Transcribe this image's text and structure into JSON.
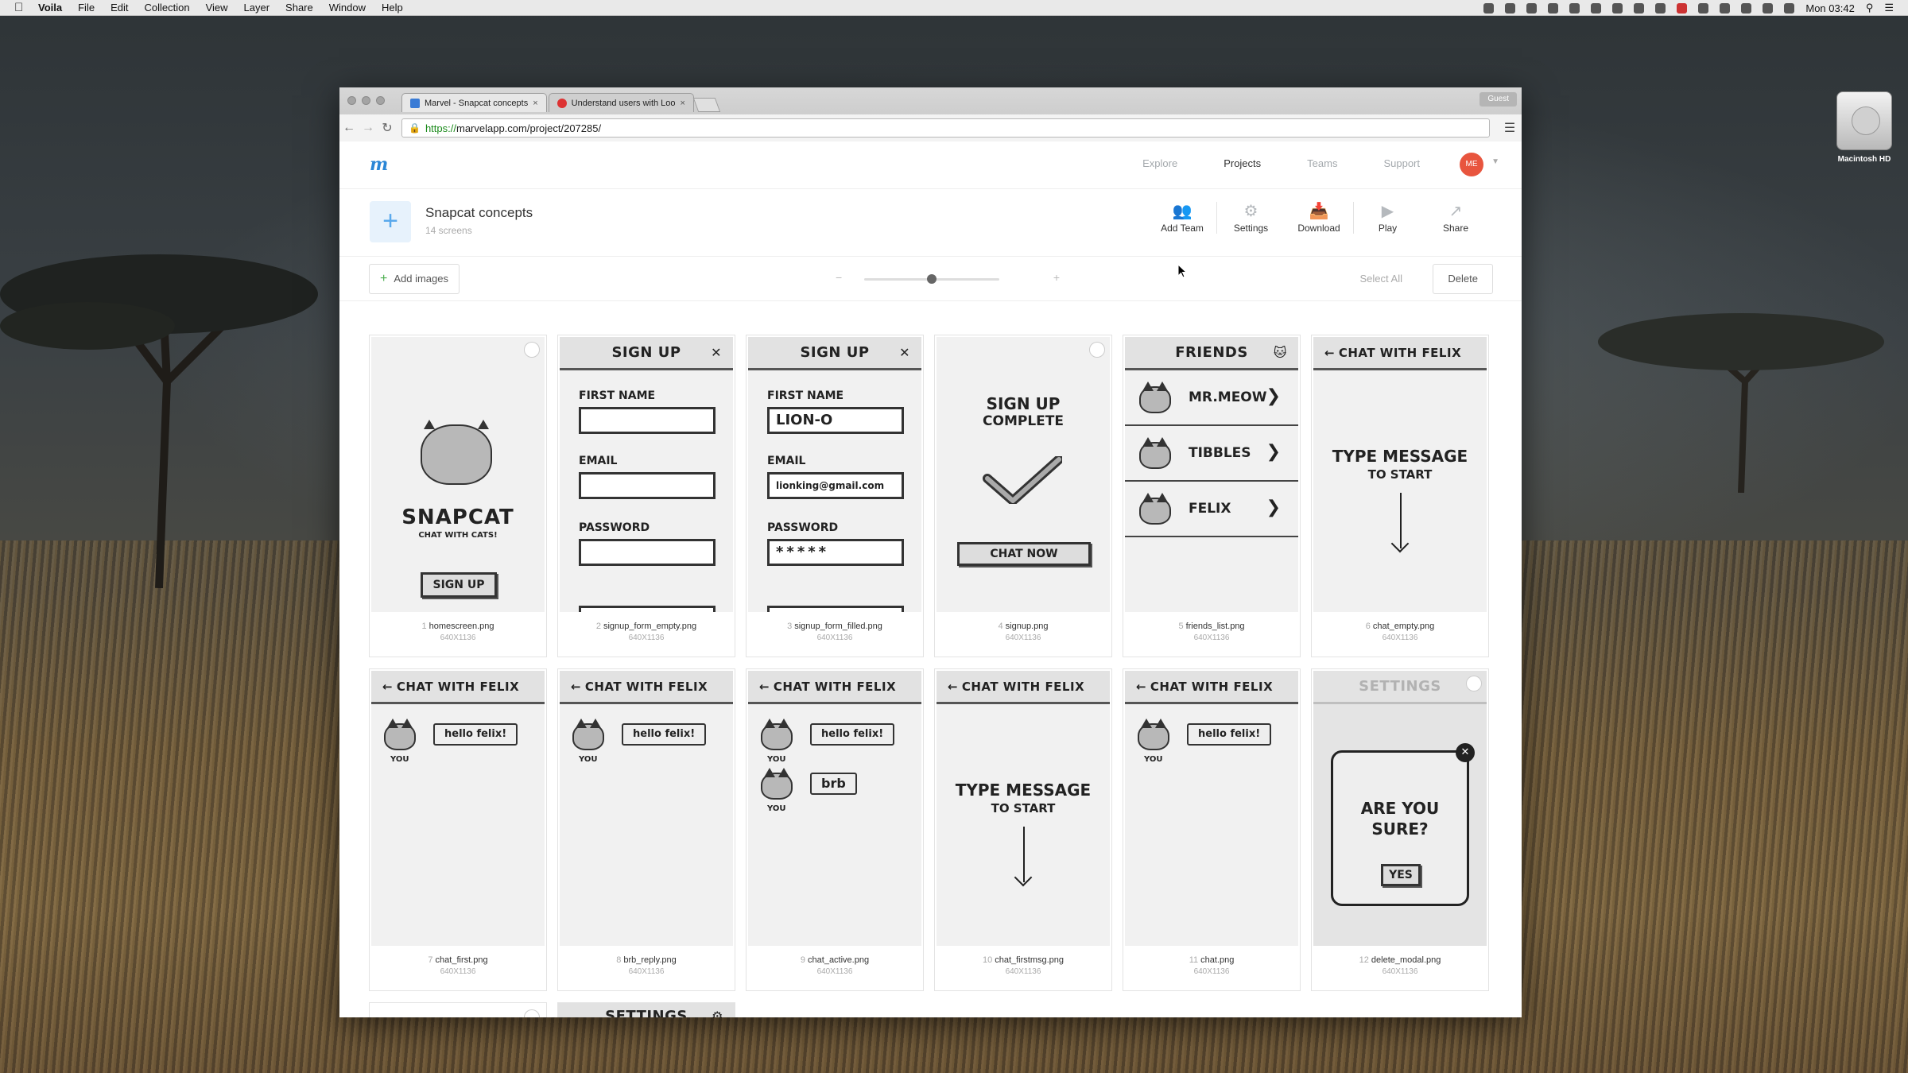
{
  "menubar": {
    "app": "Voila",
    "items": [
      "File",
      "Edit",
      "Collection",
      "View",
      "Layer",
      "Share",
      "Window",
      "Help"
    ],
    "clock": "Mon 03:42"
  },
  "desktop": {
    "drive_label": "Macintosh HD"
  },
  "browser": {
    "tabs": [
      {
        "label": "Marvel - Snapcat concepts",
        "active": true
      },
      {
        "label": "Understand users with Loo",
        "active": false
      }
    ],
    "guest_label": "Guest",
    "url_scheme": "https://",
    "url_rest": "marvelapp.com/project/207285/"
  },
  "marvel": {
    "logo": "m",
    "nav": [
      "Explore",
      "Projects",
      "Teams",
      "Support"
    ],
    "avatar_initials": "ME",
    "project_title": "Snapcat concepts",
    "project_sub": "14 screens",
    "tools": [
      {
        "icon": "add-team-icon",
        "label": "Add Team"
      },
      {
        "icon": "settings-icon",
        "label": "Settings"
      },
      {
        "icon": "download-icon",
        "label": "Download"
      },
      {
        "icon": "play-icon",
        "label": "Play"
      },
      {
        "icon": "share-icon",
        "label": "Share"
      }
    ],
    "add_images": "Add images",
    "select_all": "Select All",
    "delete": "Delete",
    "zoom_fraction": 0.5
  },
  "screens": [
    {
      "num": "1",
      "file": "homescreen.png",
      "size": "640X1136"
    },
    {
      "num": "2",
      "file": "signup_form_empty.png",
      "size": "640X1136"
    },
    {
      "num": "3",
      "file": "signup_form_filled.png",
      "size": "640X1136"
    },
    {
      "num": "4",
      "file": "signup.png",
      "size": "640X1136"
    },
    {
      "num": "5",
      "file": "friends_list.png",
      "size": "640X1136"
    },
    {
      "num": "6",
      "file": "chat_empty.png",
      "size": "640X1136"
    },
    {
      "num": "7",
      "file": "chat_first.png",
      "size": "640X1136"
    },
    {
      "num": "8",
      "file": "brb_reply.png",
      "size": "640X1136"
    },
    {
      "num": "9",
      "file": "chat_active.png",
      "size": "640X1136"
    },
    {
      "num": "10",
      "file": "chat_firstmsg.png",
      "size": "640X1136"
    },
    {
      "num": "11",
      "file": "chat.png",
      "size": "640X1136"
    },
    {
      "num": "12",
      "file": "delete_modal.png",
      "size": "640X1136"
    }
  ],
  "sketch": {
    "brand": "SNAPCAT",
    "tagline": "CHAT WITH CATS!",
    "signup_btn": "SIGN UP",
    "signup_title": "SIGN UP",
    "first_name": "FIRST NAME",
    "email": "EMAIL",
    "password": "PASSWORD",
    "filled_name": "LION-O",
    "filled_email": "lionking@gmail.com",
    "filled_password": "*****",
    "complete_1": "SIGN UP",
    "complete_2": "COMPLETE",
    "chat_now": "CHAT NOW",
    "friends_title": "FRIENDS",
    "friends": [
      "MR.MEOW",
      "TIBBLES",
      "FELIX"
    ],
    "chat_title": "CHAT WITH FELIX",
    "type_1": "TYPE MESSAGE",
    "type_2": "TO START",
    "msg_hello": "hello felix!",
    "msg_brb": "brb",
    "you": "YOU",
    "settings_title": "SETTINGS",
    "modal_1": "ARE YOU",
    "modal_2": "SURE?",
    "modal_yes": "YES"
  }
}
